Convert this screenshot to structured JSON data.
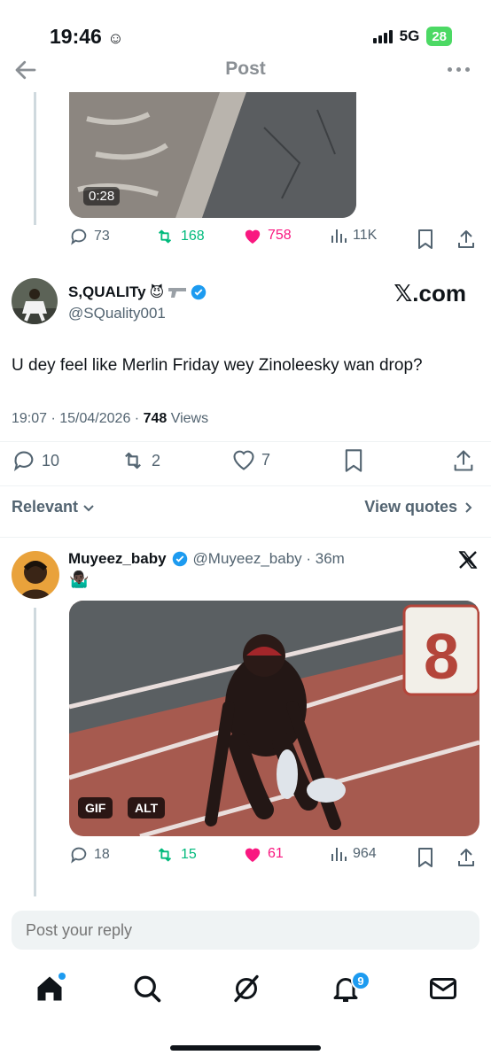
{
  "status": {
    "time": "19:46",
    "network": "5G",
    "battery": "28"
  },
  "header": {
    "title": "Post"
  },
  "prev_tweet": {
    "video_duration": "0:28",
    "actions": {
      "replies": "73",
      "retweets": "168",
      "likes": "758",
      "views": "11K"
    }
  },
  "main_tweet": {
    "display_name": "S,QUALITy",
    "handle": "@SQuality001",
    "source_badge": "𝕏.com",
    "text": "U dey feel like Merlin Friday wey Zinoleesky wan drop?",
    "time": "19:07 · 15/04/2026 · ",
    "views_count": "748",
    "views_label": " Views",
    "actions": {
      "replies": "10",
      "retweets": "2",
      "likes": "7"
    }
  },
  "sort": {
    "relevant_label": "Relevant",
    "view_quotes_label": "View quotes"
  },
  "reply_tweet": {
    "display_name": "Muyeez_baby",
    "handle": "@Muyeez_baby · 36m",
    "emoji": "🤷🏿‍♂️",
    "gif_label": "GIF",
    "alt_label": "ALT",
    "actions": {
      "replies": "18",
      "retweets": "15",
      "likes": "61",
      "views": "964"
    }
  },
  "reply_box": {
    "placeholder": "Post your reply"
  },
  "tabbar": {
    "notifications_count": "9"
  },
  "colors": {
    "accent": "#1d9bf0",
    "like": "#f91880",
    "retweet": "#00ba7c",
    "muted": "#536471"
  }
}
